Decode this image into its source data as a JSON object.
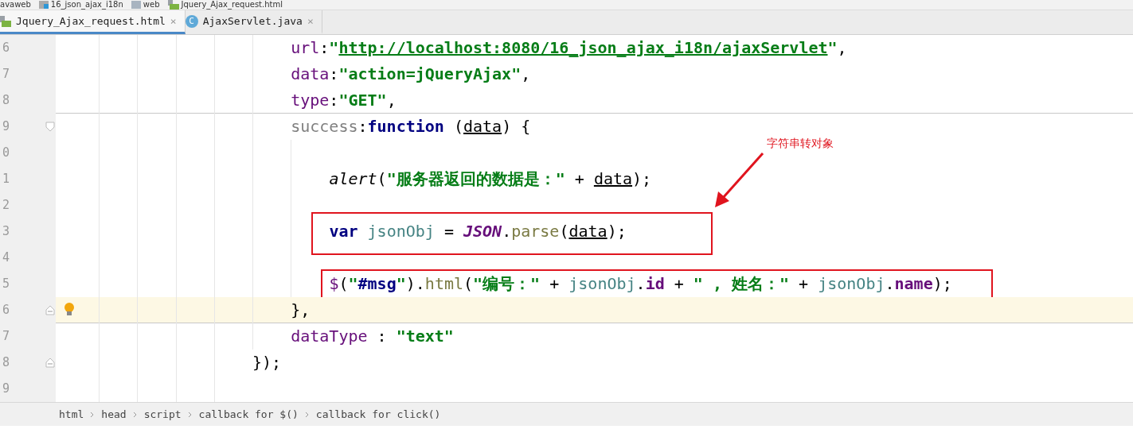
{
  "breadcrumbs": [
    {
      "label": "avaweb"
    },
    {
      "label": "16_json_ajax_i18n"
    },
    {
      "label": "web"
    },
    {
      "label": "Jquery_Ajax_request.html"
    }
  ],
  "tabs": [
    {
      "label": "Jquery_Ajax_request.html",
      "kind": "html",
      "close": "×",
      "selected": true
    },
    {
      "label": "AjaxServlet.java",
      "kind": "class",
      "icon_letter": "C",
      "close": "×",
      "selected": false
    }
  ],
  "editor": {
    "lines": [
      {
        "number": "6",
        "kind": "prop",
        "current": false,
        "boxed": false,
        "separator_below": false,
        "tokens": [
          {
            "t": "url",
            "kind": "prop"
          },
          {
            "t": ":",
            "kind": "plain"
          },
          {
            "t": "\"",
            "kind": "str"
          },
          {
            "t": "http://localhost:8080/16_json_ajax_i18n/ajaxServlet",
            "kind": "link"
          },
          {
            "t": "\"",
            "kind": "str"
          },
          {
            "t": ",",
            "kind": "plain"
          }
        ]
      },
      {
        "number": "7",
        "kind": "prop",
        "current": false,
        "boxed": false,
        "separator_below": false,
        "tokens": [
          {
            "t": "data",
            "kind": "prop"
          },
          {
            "t": ":",
            "kind": "plain"
          },
          {
            "t": "\"action=jQueryAjax\"",
            "kind": "str"
          },
          {
            "t": ",",
            "kind": "plain"
          }
        ]
      },
      {
        "number": "8",
        "kind": "prop",
        "current": false,
        "boxed": false,
        "separator_below": true,
        "tokens": [
          {
            "t": "type",
            "kind": "prop"
          },
          {
            "t": ":",
            "kind": "plain"
          },
          {
            "t": "\"GET\"",
            "kind": "str"
          },
          {
            "t": ",",
            "kind": "plain"
          }
        ]
      },
      {
        "number": "9",
        "kind": "prop",
        "fold": {
          "kind": "start"
        },
        "current": false,
        "boxed": false,
        "separator_below": false,
        "tokens": [
          {
            "t": "success",
            "kind": "unused"
          },
          {
            "t": ":",
            "kind": "plain"
          },
          {
            "t": "function",
            "kind": "kw"
          },
          {
            "t": " (",
            "kind": "plain"
          },
          {
            "t": "data",
            "kind": "param"
          },
          {
            "t": ") {",
            "kind": "plain"
          }
        ]
      },
      {
        "number": "0",
        "kind": "inner",
        "current": false,
        "boxed": false,
        "separator_below": false
      },
      {
        "number": "1",
        "kind": "inner",
        "current": false,
        "boxed": false,
        "separator_below": false,
        "tokens": [
          {
            "t": "alert",
            "kind": "italic"
          },
          {
            "t": "(",
            "kind": "plain"
          },
          {
            "t": "\"服务器返回的数据是：\"",
            "kind": "str"
          },
          {
            "t": " + ",
            "kind": "plain"
          },
          {
            "t": "data",
            "kind": "param"
          },
          {
            "t": ");",
            "kind": "plain"
          }
        ]
      },
      {
        "number": "2",
        "kind": "inner",
        "current": false,
        "boxed": false,
        "separator_below": false
      },
      {
        "number": "3",
        "kind": "inner",
        "current": false,
        "boxed": true,
        "separator_below": false,
        "tokens": [
          {
            "t": "var",
            "kind": "kw"
          },
          {
            "t": " jsonObj",
            "kind": "ident"
          },
          {
            "t": " = ",
            "kind": "plain"
          },
          {
            "t": "JSON",
            "kind": "global"
          },
          {
            "t": ".",
            "kind": "plain"
          },
          {
            "t": "parse",
            "kind": "fn"
          },
          {
            "t": "(",
            "kind": "plain"
          },
          {
            "t": "data",
            "kind": "param"
          },
          {
            "t": ");",
            "kind": "plain"
          }
        ]
      },
      {
        "number": "4",
        "kind": "inner",
        "current": false,
        "boxed": false,
        "separator_below": false
      },
      {
        "number": "5",
        "kind": "inner",
        "current": false,
        "boxed": true,
        "separator_below": false,
        "tokens": [
          {
            "t": "$",
            "kind": "prop"
          },
          {
            "t": "(",
            "kind": "plain"
          },
          {
            "t": "\"",
            "kind": "str"
          },
          {
            "t": "#msg",
            "kind": "kw"
          },
          {
            "t": "\"",
            "kind": "str"
          },
          {
            "t": ").",
            "kind": "plain"
          },
          {
            "t": "html",
            "kind": "fn"
          },
          {
            "t": "(",
            "kind": "plain"
          },
          {
            "t": "\"编号：\"",
            "kind": "str"
          },
          {
            "t": " + ",
            "kind": "plain"
          },
          {
            "t": "jsonObj",
            "kind": "ident"
          },
          {
            "t": ".",
            "kind": "plain"
          },
          {
            "t": "id",
            "kind": "field"
          },
          {
            "t": " + ",
            "kind": "plain"
          },
          {
            "t": "\" , 姓名：\"",
            "kind": "str"
          },
          {
            "t": " + ",
            "kind": "plain"
          },
          {
            "t": "jsonObj",
            "kind": "ident"
          },
          {
            "t": ".",
            "kind": "plain"
          },
          {
            "t": "name",
            "kind": "field"
          },
          {
            "t": ");",
            "kind": "plain"
          }
        ]
      },
      {
        "number": "6",
        "kind": "prop",
        "fold": {
          "kind": "end"
        },
        "bulb": true,
        "current": true,
        "boxed": false,
        "separator_below": true,
        "tokens": [
          {
            "t": "},",
            "kind": "plain"
          }
        ]
      },
      {
        "number": "7",
        "kind": "prop",
        "current": false,
        "boxed": false,
        "separator_below": false,
        "tokens": [
          {
            "t": "dataType",
            "kind": "prop"
          },
          {
            "t": " : ",
            "kind": "plain"
          },
          {
            "t": "\"text\"",
            "kind": "str"
          }
        ]
      },
      {
        "number": "8",
        "kind": "outer",
        "fold": {
          "kind": "end"
        },
        "current": false,
        "boxed": false,
        "separator_below": false,
        "tokens": [
          {
            "t": "});",
            "kind": "plain"
          }
        ]
      },
      {
        "number": "9",
        "kind": "outer",
        "current": false,
        "boxed": false,
        "separator_below": false
      }
    ]
  },
  "annotation": {
    "label": "字符串转对象"
  },
  "status_bar": {
    "path": [
      "html",
      "head",
      "script",
      "callback for $()",
      "callback for click()"
    ]
  }
}
